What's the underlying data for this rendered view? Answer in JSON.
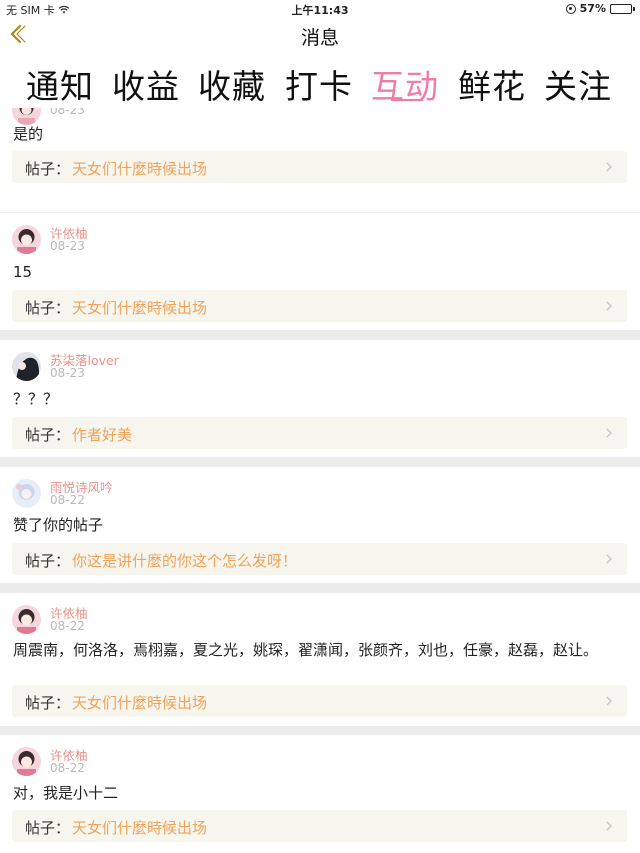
{
  "status_bar": {
    "carrier": "无 SIM 卡",
    "time": "上午11:43",
    "battery": "57%",
    "battery_level": 0.57
  },
  "nav": {
    "title": "消息",
    "back_icon": "chevron-left-icon"
  },
  "tabs": [
    {
      "label": "通知",
      "active": false
    },
    {
      "label": "收益",
      "active": false
    },
    {
      "label": "收藏",
      "active": false
    },
    {
      "label": "打卡",
      "active": false
    },
    {
      "label": "互动",
      "active": true
    },
    {
      "label": "鲜花",
      "active": false
    },
    {
      "label": "关注",
      "active": false
    }
  ],
  "accent_color": "#f07aa8",
  "post_label": "帖子：",
  "items": [
    {
      "user": "",
      "date": "08-23",
      "content": "是的",
      "post_title": "天女们什麼時候出场"
    },
    {
      "user": "许依柚",
      "date": "08-23",
      "content": "15",
      "post_title": "天女们什麼時候出场"
    },
    {
      "user": "苏柒落lover",
      "date": "08-23",
      "content": "？？？",
      "post_title": "作者好美"
    },
    {
      "user": "雨悦诗风吟",
      "date": "08-22",
      "content": "赞了你的帖子",
      "post_title": "你这是讲什麼的你这个怎么发呀！"
    },
    {
      "user": "许依柚",
      "date": "08-22",
      "content": "周震南，何洛洛，焉栩嘉，夏之光，姚琛，翟潇闻，张颜齐，刘也，任豪，赵磊，赵让。",
      "post_title": "天女们什麼時候出场"
    },
    {
      "user": "许依柚",
      "date": "08-22",
      "content": "对，我是小十二",
      "post_title": "天女们什麼時候出场"
    }
  ]
}
